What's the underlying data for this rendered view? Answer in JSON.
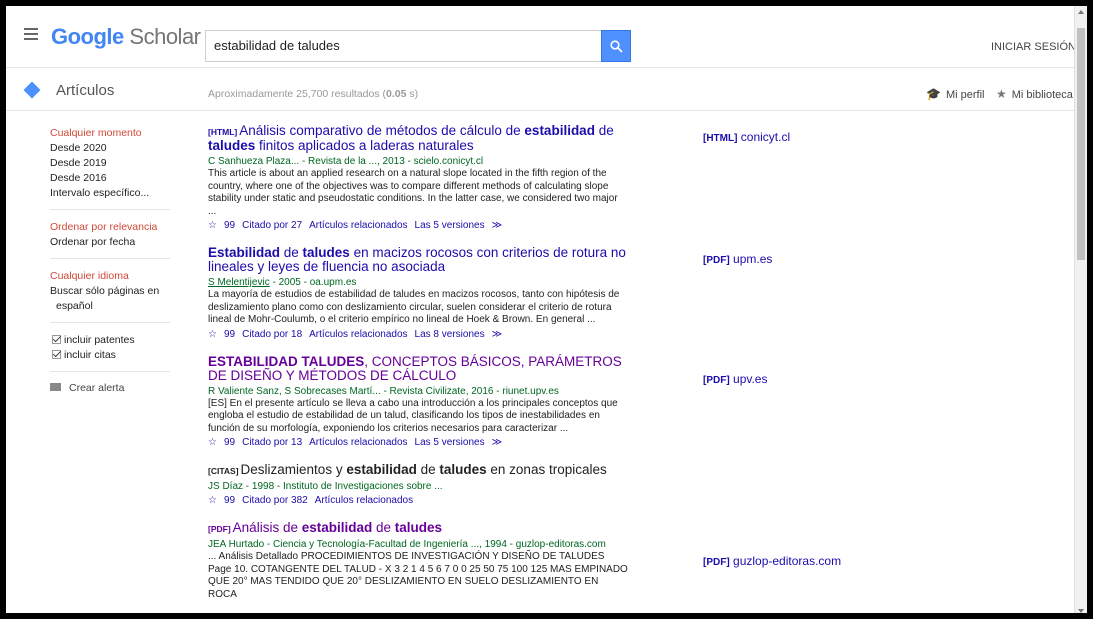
{
  "header": {
    "logo_google": "Google",
    "logo_scholar": "Scholar",
    "search_value": "estabilidad de taludes",
    "signin": "INICIAR SESIÓN"
  },
  "subbar": {
    "articles": "Artículos",
    "results_prefix": "Aproximadamente 25,700 resultados (",
    "results_time": "0.05",
    "results_suffix": " s)",
    "my_profile": "Mi perfil",
    "my_library": "Mi biblioteca"
  },
  "sidebar": {
    "time": [
      "Cualquier momento",
      "Desde 2020",
      "Desde 2019",
      "Desde 2016",
      "Intervalo específico..."
    ],
    "sort": [
      "Ordenar por relevancia",
      "Ordenar por fecha"
    ],
    "lang": [
      "Cualquier idioma",
      "Buscar sólo páginas en",
      "español"
    ],
    "check_patents": "incluir patentes",
    "check_citations": "incluir citas",
    "alert": "Crear alerta"
  },
  "results": [
    {
      "tag": "[HTML]",
      "title_a": "Análisis comparativo de métodos de cálculo de ",
      "title_b": "estabilidad",
      "title_c": " de ",
      "title_d": "taludes",
      "title_e": " finitos aplicados a laderas naturales",
      "meta": "C Sanhueza Plaza... - Revista de la ..., 2013 - scielo.conicyt.cl",
      "snippet": "This article is about an applied research on a natural slope located in the fifth region of the country, where one of the objectives was to compare different methods of calculating slope stability under static and pseudostatic conditions. In the latter case, we considered two major ...",
      "cited": "Citado por 27",
      "related": "Artículos relacionados",
      "versions": "Las 5 versiones",
      "side": "conicyt.cl",
      "side_tag": "[HTML]"
    },
    {
      "title_a": "Estabilidad",
      "title_b": " de ",
      "title_c": "taludes",
      "title_d": " en macizos rocosos con criterios de rotura no lineales y leyes de fluencia no asociada",
      "meta_author": "S Melentijevic",
      "meta_rest": " - 2005 - oa.upm.es",
      "snippet": "La mayoría de estudios de estabilidad de taludes en macizos rocosos, tanto con hipótesis de deslizamiento plano como con deslizamiento circular, suelen considerar el criterio de rotura lineal de Mohr-Coulumb, o el criterio empírico no lineal de Hoek & Brown. En general ...",
      "cited": "Citado por 18",
      "related": "Artículos relacionados",
      "versions": "Las 8 versiones",
      "side": "upm.es",
      "side_tag": "[PDF]"
    },
    {
      "title_a": "ESTABILIDAD TALUDES",
      "title_b": ", CONCEPTOS BÁSICOS, PARÁMETROS DE DISEÑO Y MÉTODOS DE CÁLCULO",
      "meta": "R Valiente Sanz, S Sobrecases Martí... - Revista Civilizate, 2016 - riunet.upv.es",
      "snippet": "[ES] En el presente artículo se lleva a cabo una introducción a los principales conceptos que engloba el estudio de estabilidad de un talud, clasificando los tipos de inestabilidades en función de su morfología, exponiendo los criterios necesarios para caracterizar ...",
      "cited": "Citado por 13",
      "related": "Artículos relacionados",
      "versions": "Las 5 versiones",
      "side": "upv.es",
      "side_tag": "[PDF]"
    },
    {
      "tag": "[CITAS]",
      "title_a": "Deslizamientos y ",
      "title_b": "estabilidad",
      "title_c": " de ",
      "title_d": "taludes",
      "title_e": " en zonas tropicales",
      "meta": "JS Díaz - 1998 - Instituto de Investigaciones sobre ...",
      "cited": "Citado por 382",
      "related": "Artículos relacionados"
    },
    {
      "tag": "[PDF]",
      "title_a": "Análisis de ",
      "title_b": "estabilidad",
      "title_c": " de ",
      "title_d": "taludes",
      "meta": "JEA Hurtado - Ciencia y Tecnología-Facultad de Ingeniería ..., 1994 - guzlop-editoras.com",
      "snippet": "... Análisis Detallado PROCEDIMIENTOS DE INVESTIGACIÓN Y DISEÑO DE TALUDES Page 10. COTANGENTE DEL TALUD - X 3 2 1 4 5 6 7 0 0 25 50 75 100 125 MAS EMPINADO QUE 20° MAS TENDIDO QUE 20° DESLIZAMIENTO EN SUELO DESLIZAMIENTO EN ROCA",
      "side": "guzlop-editoras.com",
      "side_tag": "[PDF]"
    }
  ],
  "icons": {
    "star": "☆",
    "quote": "99",
    "versions": "≫"
  }
}
